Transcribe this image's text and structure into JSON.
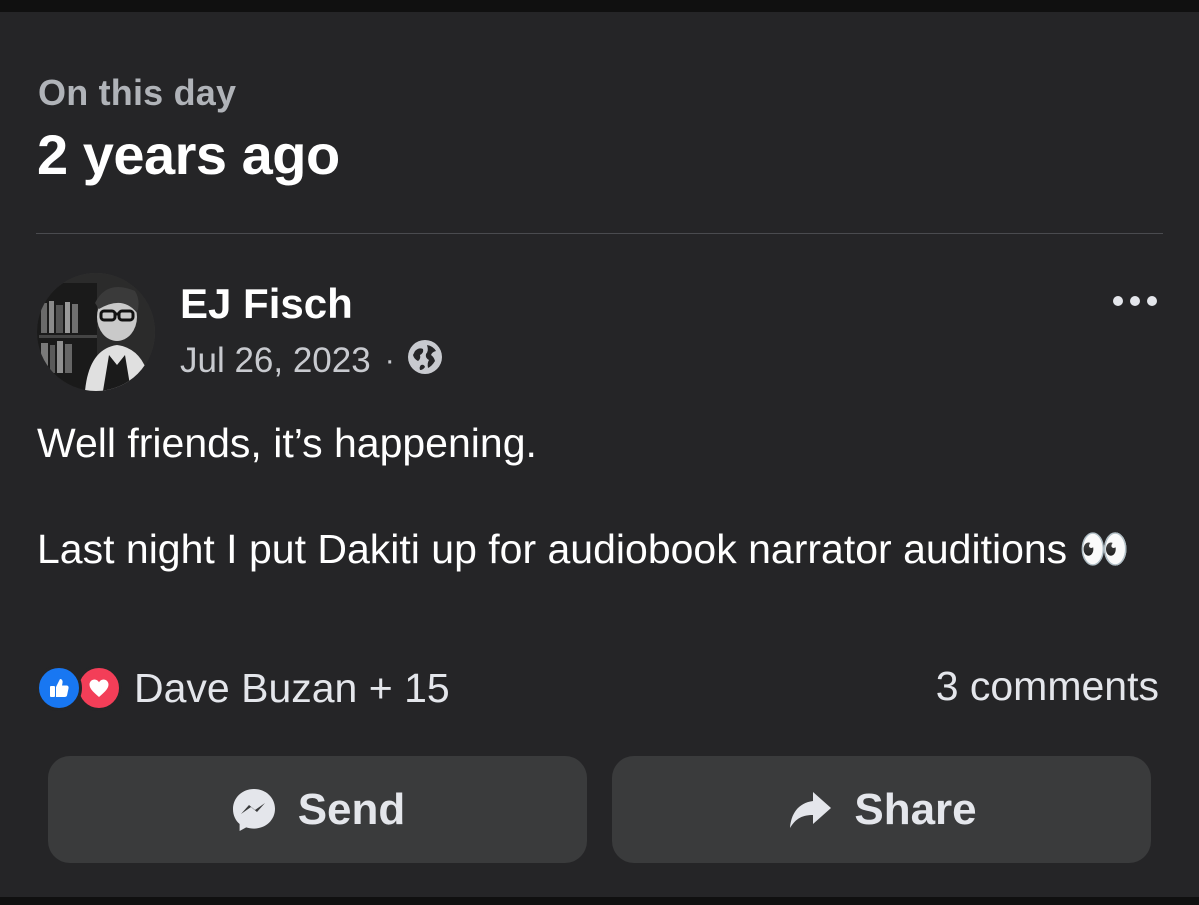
{
  "memory": {
    "eyebrow": "On this day",
    "headline": "2 years ago"
  },
  "post": {
    "author": "EJ Fisch",
    "date": "Jul 26, 2023",
    "separator": "·",
    "audience_icon": "globe-icon",
    "text": "Well friends, it’s happening.\n\nLast night I put Dakiti up for audiobook narrator auditions 👀"
  },
  "engagement": {
    "reaction_icons": [
      "like-icon",
      "love-icon"
    ],
    "reactors": "Dave Buzan + 15",
    "comments": "3 comments"
  },
  "actions": {
    "send_label": "Send",
    "share_label": "Share"
  },
  "colors": {
    "background": "#252527",
    "like": "#1877f2",
    "love": "#f33e58",
    "button": "#3a3b3c",
    "secondary_text": "#b0b3b8"
  }
}
